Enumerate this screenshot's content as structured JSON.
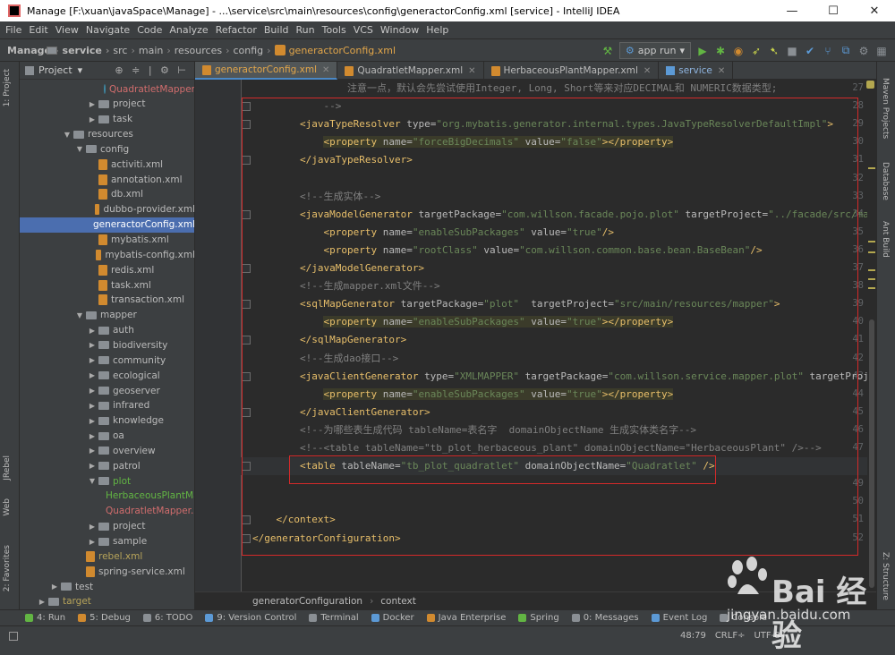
{
  "window": {
    "title": "Manage [F:\\xuan\\javaSpace\\Manage] - ...\\service\\src\\main\\resources\\config\\generactorConfig.xml [service] - IntelliJ IDEA",
    "minimize": "—",
    "maximize": "☐",
    "close": "✕"
  },
  "menu": [
    "File",
    "Edit",
    "View",
    "Navigate",
    "Code",
    "Analyze",
    "Refactor",
    "Build",
    "Run",
    "Tools",
    "VCS",
    "Window",
    "Help"
  ],
  "breadcrumbs": [
    "Manage",
    "service",
    "src",
    "main",
    "resources",
    "config",
    "generactorConfig.xml"
  ],
  "run_config": "app run",
  "left_tabs": [
    "1: Project",
    "JRebel",
    "Web",
    "2: Favorites"
  ],
  "right_tabs": [
    "Maven Projects",
    "Database",
    "Ant Build",
    "Z: Structure"
  ],
  "project_panel": {
    "title": "Project",
    "tree": [
      {
        "label": "QuadratletMapper",
        "kind": "class",
        "color": "red",
        "level": 7,
        "arrow": ""
      },
      {
        "label": "project",
        "kind": "folder",
        "level": 6,
        "arrow": "▶"
      },
      {
        "label": "task",
        "kind": "folder",
        "level": 6,
        "arrow": "▶"
      },
      {
        "label": "resources",
        "kind": "folder",
        "level": 4,
        "arrow": "▼"
      },
      {
        "label": "config",
        "kind": "folder",
        "level": 5,
        "arrow": "▼"
      },
      {
        "label": "activiti.xml",
        "kind": "file",
        "level": 6,
        "arrow": ""
      },
      {
        "label": "annotation.xml",
        "kind": "file",
        "level": 6,
        "arrow": ""
      },
      {
        "label": "db.xml",
        "kind": "file",
        "level": 6,
        "arrow": ""
      },
      {
        "label": "dubbo-provider.xml",
        "kind": "file",
        "level": 6,
        "arrow": ""
      },
      {
        "label": "generactorConfig.xml",
        "kind": "file",
        "level": 6,
        "arrow": "",
        "selected": true
      },
      {
        "label": "mybatis.xml",
        "kind": "file",
        "level": 6,
        "arrow": ""
      },
      {
        "label": "mybatis-config.xml",
        "kind": "file",
        "level": 6,
        "arrow": ""
      },
      {
        "label": "redis.xml",
        "kind": "file",
        "level": 6,
        "arrow": ""
      },
      {
        "label": "task.xml",
        "kind": "file",
        "level": 6,
        "arrow": ""
      },
      {
        "label": "transaction.xml",
        "kind": "file",
        "level": 6,
        "arrow": ""
      },
      {
        "label": "mapper",
        "kind": "folder",
        "level": 5,
        "arrow": "▼"
      },
      {
        "label": "auth",
        "kind": "folder",
        "level": 6,
        "arrow": "▶"
      },
      {
        "label": "biodiversity",
        "kind": "folder",
        "level": 6,
        "arrow": "▶"
      },
      {
        "label": "community",
        "kind": "folder",
        "level": 6,
        "arrow": "▶"
      },
      {
        "label": "ecological",
        "kind": "folder",
        "level": 6,
        "arrow": "▶"
      },
      {
        "label": "geoserver",
        "kind": "folder",
        "level": 6,
        "arrow": "▶"
      },
      {
        "label": "infrared",
        "kind": "folder",
        "level": 6,
        "arrow": "▶"
      },
      {
        "label": "knowledge",
        "kind": "folder",
        "level": 6,
        "arrow": "▶"
      },
      {
        "label": "oa",
        "kind": "folder",
        "level": 6,
        "arrow": "▶"
      },
      {
        "label": "overview",
        "kind": "folder",
        "level": 6,
        "arrow": "▶"
      },
      {
        "label": "patrol",
        "kind": "folder",
        "level": 6,
        "arrow": "▶"
      },
      {
        "label": "plot",
        "kind": "folder",
        "color": "green",
        "level": 6,
        "arrow": "▼"
      },
      {
        "label": "HerbaceousPlantMapper.xml",
        "kind": "file",
        "color": "green",
        "level": 7,
        "arrow": ""
      },
      {
        "label": "QuadratletMapper.xml",
        "kind": "file",
        "color": "red",
        "level": 7,
        "arrow": ""
      },
      {
        "label": "project",
        "kind": "folder",
        "level": 6,
        "arrow": "▶"
      },
      {
        "label": "sample",
        "kind": "folder",
        "level": 6,
        "arrow": "▶"
      },
      {
        "label": "rebel.xml",
        "kind": "file",
        "color": "yellow",
        "level": 5,
        "arrow": ""
      },
      {
        "label": "spring-service.xml",
        "kind": "file",
        "level": 5,
        "arrow": ""
      },
      {
        "label": "test",
        "kind": "folder",
        "level": 3,
        "arrow": "▶"
      },
      {
        "label": "target",
        "kind": "folder",
        "color": "yellow",
        "level": 2,
        "arrow": "▶"
      }
    ]
  },
  "editor_tabs": [
    {
      "label": "generactorConfig.xml",
      "active": true,
      "kind": "xml"
    },
    {
      "label": "QuadratletMapper.xml",
      "active": false,
      "kind": "xml"
    },
    {
      "label": "HerbaceousPlantMapper.xml",
      "active": false,
      "kind": "xml"
    },
    {
      "label": "service",
      "active": false,
      "kind": "svc"
    }
  ],
  "code_lines": [
    {
      "n": "27",
      "segs": [
        [
          "cm",
          "                注意一点，默认会先尝试使用Integer, Long, Short等来对应DECIMAL和 NUMERIC数据类型;"
        ]
      ]
    },
    {
      "n": "28",
      "segs": [
        [
          "cm",
          "            -->"
        ]
      ]
    },
    {
      "n": "29",
      "segs": [
        [
          "tx",
          "        "
        ],
        [
          "tg",
          "<javaTypeResolver "
        ],
        [
          "an",
          "type="
        ],
        [
          "av",
          "\"org.mybatis.generator.internal.types.JavaTypeResolverDefaultImpl\""
        ],
        [
          "tg",
          ">"
        ]
      ]
    },
    {
      "n": "30",
      "segs": [
        [
          "tx",
          "            "
        ],
        [
          "tg",
          "<property "
        ],
        [
          "an",
          "name="
        ],
        [
          "av",
          "\"forceBigDecimals\""
        ],
        [
          "an",
          " value="
        ],
        [
          "av",
          "\"false\""
        ],
        [
          "tg",
          "></property>"
        ]
      ],
      "bg": true
    },
    {
      "n": "31",
      "segs": [
        [
          "tx",
          "        "
        ],
        [
          "tg",
          "</javaTypeResolver>"
        ]
      ]
    },
    {
      "n": "32",
      "segs": [
        [
          "tx",
          ""
        ]
      ]
    },
    {
      "n": "33",
      "segs": [
        [
          "cm",
          "        <!--生成实体-->"
        ]
      ]
    },
    {
      "n": "34",
      "segs": [
        [
          "tx",
          "        "
        ],
        [
          "tg",
          "<javaModelGenerator "
        ],
        [
          "an",
          "targetPackage="
        ],
        [
          "av",
          "\"com.willson.facade.pojo.plot\""
        ],
        [
          "an",
          " targetProject="
        ],
        [
          "av",
          "\"../facade/src/main/java\""
        ]
      ]
    },
    {
      "n": "35",
      "segs": [
        [
          "tx",
          "            "
        ],
        [
          "tg",
          "<property "
        ],
        [
          "an",
          "name="
        ],
        [
          "av",
          "\"enableSubPackages\""
        ],
        [
          "an",
          " value="
        ],
        [
          "av",
          "\"true\""
        ],
        [
          "tg",
          "/>"
        ]
      ]
    },
    {
      "n": "36",
      "segs": [
        [
          "tx",
          "            "
        ],
        [
          "tg",
          "<property "
        ],
        [
          "an",
          "name="
        ],
        [
          "av",
          "\"rootClass\""
        ],
        [
          "an",
          " value="
        ],
        [
          "av",
          "\"com.willson.common.base.bean.BaseBean\""
        ],
        [
          "tg",
          "/>"
        ]
      ]
    },
    {
      "n": "37",
      "segs": [
        [
          "tx",
          "        "
        ],
        [
          "tg",
          "</javaModelGenerator>"
        ]
      ]
    },
    {
      "n": "38",
      "segs": [
        [
          "cm",
          "        <!--生成mapper.xml文件-->"
        ]
      ]
    },
    {
      "n": "39",
      "segs": [
        [
          "tx",
          "        "
        ],
        [
          "tg",
          "<sqlMapGenerator "
        ],
        [
          "an",
          "targetPackage="
        ],
        [
          "av",
          "\"plot\""
        ],
        [
          "an",
          "  targetProject="
        ],
        [
          "av",
          "\"src/main/resources/mapper\""
        ],
        [
          "tg",
          ">"
        ]
      ]
    },
    {
      "n": "40",
      "segs": [
        [
          "tx",
          "            "
        ],
        [
          "tg",
          "<property "
        ],
        [
          "an",
          "name="
        ],
        [
          "av",
          "\"enableSubPackages\""
        ],
        [
          "an",
          " value="
        ],
        [
          "av",
          "\"true\""
        ],
        [
          "tg",
          "></property>"
        ]
      ],
      "bg": true
    },
    {
      "n": "41",
      "segs": [
        [
          "tx",
          "        "
        ],
        [
          "tg",
          "</sqlMapGenerator>"
        ]
      ]
    },
    {
      "n": "42",
      "segs": [
        [
          "cm",
          "        <!--生成dao接口-->"
        ]
      ]
    },
    {
      "n": "43",
      "segs": [
        [
          "tx",
          "        "
        ],
        [
          "tg",
          "<javaClientGenerator "
        ],
        [
          "an",
          "type="
        ],
        [
          "av",
          "\"XMLMAPPER\""
        ],
        [
          "an",
          " targetPackage="
        ],
        [
          "av",
          "\"com.willson.service.mapper.plot\""
        ],
        [
          "an",
          " targetProject="
        ],
        [
          "av",
          "\"src/main/java\""
        ]
      ]
    },
    {
      "n": "44",
      "segs": [
        [
          "tx",
          "            "
        ],
        [
          "tg",
          "<property "
        ],
        [
          "an",
          "name="
        ],
        [
          "av",
          "\"enableSubPackages\""
        ],
        [
          "an",
          " value="
        ],
        [
          "av",
          "\"true\""
        ],
        [
          "tg",
          "></property>"
        ]
      ],
      "bg": true
    },
    {
      "n": "45",
      "segs": [
        [
          "tx",
          "        "
        ],
        [
          "tg",
          "</javaClientGenerator>"
        ]
      ]
    },
    {
      "n": "46",
      "segs": [
        [
          "cm",
          "        <!--为哪些表生成代码 tableName=表名字  domainObjectName 生成实体类名字-->"
        ]
      ]
    },
    {
      "n": "47",
      "segs": [
        [
          "cm",
          "        <!--<table tableName=\"tb_plot_herbaceous_plant\" domainObjectName=\"HerbaceousPlant\" />-->"
        ]
      ]
    },
    {
      "n": "48",
      "segs": [
        [
          "tx",
          "        "
        ],
        [
          "tg",
          "<table "
        ],
        [
          "an",
          "tableName="
        ],
        [
          "av",
          "\"tb_plot_quadratlet\""
        ],
        [
          "an",
          " domainObjectName="
        ],
        [
          "av",
          "\"Quadratlet\""
        ],
        [
          "tg",
          " />"
        ]
      ],
      "hl": true
    },
    {
      "n": "49",
      "segs": [
        [
          "tx",
          ""
        ]
      ]
    },
    {
      "n": "50",
      "segs": [
        [
          "tx",
          ""
        ]
      ]
    },
    {
      "n": "51",
      "segs": [
        [
          "tx",
          "    "
        ],
        [
          "tg",
          "</context>"
        ]
      ]
    },
    {
      "n": "52",
      "segs": [
        [
          "tg",
          "</generatorConfiguration>"
        ]
      ]
    }
  ],
  "editor_breadcrumb": [
    "generatorConfiguration",
    "context"
  ],
  "bottom_tools": [
    {
      "label": "4: Run",
      "color": "#62b543"
    },
    {
      "label": "5: Debug",
      "color": "#d18a2f"
    },
    {
      "label": "6: TODO",
      "color": "#8a8f94"
    },
    {
      "label": "9: Version Control",
      "color": "#5c9ad6"
    },
    {
      "label": "Terminal",
      "color": "#8a8f94"
    },
    {
      "label": "Docker",
      "color": "#5c9ad6"
    },
    {
      "label": "Java Enterprise",
      "color": "#d18a2f"
    },
    {
      "label": "Spring",
      "color": "#62b543"
    },
    {
      "label": "0: Messages",
      "color": "#8a8f94"
    },
    {
      "label": "Event Log",
      "color": "#5c9ad6"
    },
    {
      "label": "Console",
      "color": "#8a8f94"
    }
  ],
  "status": {
    "position": "48:79",
    "line_sep": "CRLF÷",
    "encoding": "UTF-8÷"
  },
  "watermark": {
    "brand": "Bai 经验",
    "url": "jingyan.baidu.com"
  }
}
